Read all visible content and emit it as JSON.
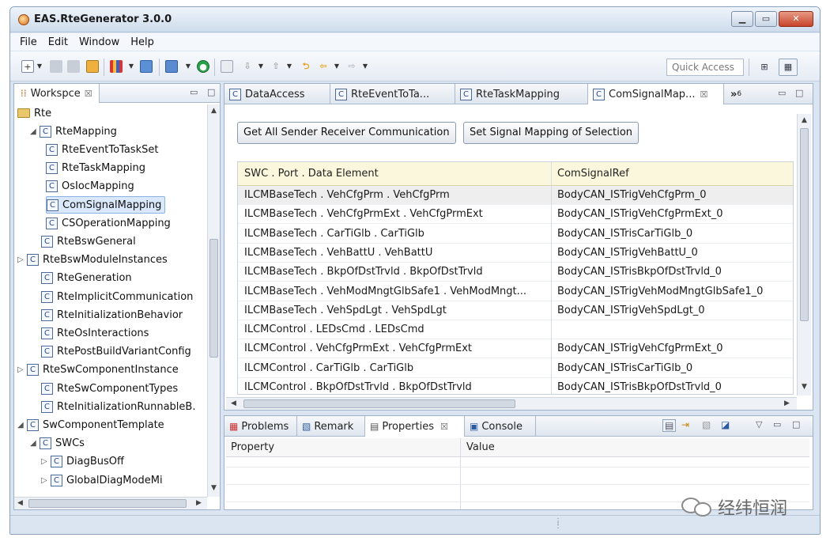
{
  "window": {
    "title": "EAS.RteGenerator 3.0.0"
  },
  "menu": [
    "File",
    "Edit",
    "Window",
    "Help"
  ],
  "toolbar": {
    "quick_access_placeholder": "Quick Access"
  },
  "workspace": {
    "tab_label": "Workspce",
    "tree": [
      {
        "label": "Rte",
        "kind": "folder"
      },
      {
        "label": "RteMapping",
        "kind": "c",
        "twisty": "◢"
      },
      {
        "label": "RteEventToTaskSet",
        "kind": "c"
      },
      {
        "label": "RteTaskMapping",
        "kind": "c"
      },
      {
        "label": "OsIocMapping",
        "kind": "c"
      },
      {
        "label": "ComSignalMapping",
        "kind": "c",
        "selected": true
      },
      {
        "label": "CSOperationMapping",
        "kind": "c"
      },
      {
        "label": "RteBswGeneral",
        "kind": "c"
      },
      {
        "label": "RteBswModuleInstances",
        "kind": "c",
        "twisty": "▷"
      },
      {
        "label": "RteGeneration",
        "kind": "c"
      },
      {
        "label": "RteImplicitCommunication",
        "kind": "c"
      },
      {
        "label": "RteInitializationBehavior",
        "kind": "c"
      },
      {
        "label": "RteOsInteractions",
        "kind": "c"
      },
      {
        "label": "RtePostBuildVariantConfig",
        "kind": "c"
      },
      {
        "label": "RteSwComponentInstance",
        "kind": "c",
        "twisty": "▷"
      },
      {
        "label": "RteSwComponentTypes",
        "kind": "c"
      },
      {
        "label": "RteInitializationRunnableB.",
        "kind": "c"
      },
      {
        "label": "SwComponentTemplate",
        "kind": "c",
        "twisty": "◢"
      },
      {
        "label": "SWCs",
        "kind": "c",
        "twisty": "◢"
      },
      {
        "label": "DiagBusOff",
        "kind": "c",
        "twisty": "▷"
      },
      {
        "label": "GlobalDiagModeMi",
        "kind": "c",
        "twisty": "▷"
      }
    ]
  },
  "editor": {
    "tabs": [
      {
        "label": "DataAccess"
      },
      {
        "label": "RteEventToTa..."
      },
      {
        "label": "RteTaskMapping"
      },
      {
        "label": "ComSignalMap...",
        "active": true
      }
    ],
    "overflow_label": "»",
    "overflow_count": "6",
    "buttons": {
      "get_all": "Get All Sender Receiver Communication",
      "set_mapping": "Set Signal Mapping of Selection"
    },
    "columns": [
      "SWC . Port . Data Element",
      "ComSignalRef"
    ],
    "rows": [
      [
        "ILCMBaseTech . VehCfgPrm . VehCfgPrm",
        "BodyCAN_ISTrigVehCfgPrm_0"
      ],
      [
        "ILCMBaseTech . VehCfgPrmExt . VehCfgPrmExt",
        "BodyCAN_ISTrigVehCfgPrmExt_0"
      ],
      [
        "ILCMBaseTech . CarTiGlb . CarTiGlb",
        "BodyCAN_ISTrisCarTiGlb_0"
      ],
      [
        "ILCMBaseTech . VehBattU . VehBattU",
        "BodyCAN_ISTrigVehBattU_0"
      ],
      [
        "ILCMBaseTech . BkpOfDstTrvld . BkpOfDstTrvld",
        "BodyCAN_ISTrisBkpOfDstTrvld_0"
      ],
      [
        "ILCMBaseTech . VehModMngtGlbSafe1 . VehModMngt...",
        "BodyCAN_ISTrigVehModMngtGlbSafe1_0"
      ],
      [
        "ILCMBaseTech . VehSpdLgt . VehSpdLgt",
        "BodyCAN_ISTrigVehSpdLgt_0"
      ],
      [
        "ILCMControl . LEDsCmd . LEDsCmd",
        ""
      ],
      [
        "ILCMControl . VehCfgPrmExt . VehCfgPrmExt",
        "BodyCAN_ISTrigVehCfgPrmExt_0"
      ],
      [
        "ILCMControl . CarTiGlb . CarTiGlb",
        "BodyCAN_ISTrisCarTiGlb_0"
      ],
      [
        "ILCMControl . BkpOfDstTrvld . BkpOfDstTrvld",
        "BodyCAN_ISTrisBkpOfDstTrvld_0"
      ]
    ]
  },
  "bottom": {
    "tabs": [
      {
        "label": "Problems"
      },
      {
        "label": "Remark"
      },
      {
        "label": "Properties",
        "active": true
      },
      {
        "label": "Console"
      }
    ],
    "columns": [
      "Property",
      "Value"
    ]
  },
  "watermark": {
    "text": "经纬恒润"
  }
}
